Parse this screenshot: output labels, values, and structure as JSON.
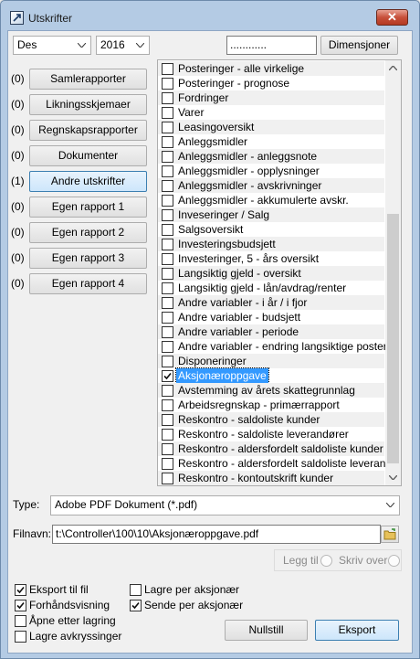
{
  "window": {
    "title": "Utskrifter",
    "close_label": "✕"
  },
  "filters": {
    "month": "Des",
    "year": "2016",
    "search_value": "............",
    "dimensions_label": "Dimensjoner"
  },
  "reports": [
    {
      "count": "(0)",
      "label": "Samlerapporter",
      "active": false
    },
    {
      "count": "(0)",
      "label": "Likningsskjemaer",
      "active": false
    },
    {
      "count": "(0)",
      "label": "Regnskapsrapporter",
      "active": false
    },
    {
      "count": "(0)",
      "label": "Dokumenter",
      "active": false
    },
    {
      "count": "(1)",
      "label": "Andre utskrifter",
      "active": true
    },
    {
      "count": "(0)",
      "label": "Egen rapport 1",
      "active": false
    },
    {
      "count": "(0)",
      "label": "Egen rapport 2",
      "active": false
    },
    {
      "count": "(0)",
      "label": "Egen rapport 3",
      "active": false
    },
    {
      "count": "(0)",
      "label": "Egen rapport 4",
      "active": false
    }
  ],
  "report_list": [
    {
      "label": "Posteringer - alle virkelige",
      "checked": false
    },
    {
      "label": "Posteringer - prognose",
      "checked": false
    },
    {
      "label": "Fordringer",
      "checked": false
    },
    {
      "label": "Varer",
      "checked": false
    },
    {
      "label": "Leasingoversikt",
      "checked": false
    },
    {
      "label": "Anleggsmidler",
      "checked": false
    },
    {
      "label": "Anleggsmidler - anleggsnote",
      "checked": false
    },
    {
      "label": "Anleggsmidler - opplysninger",
      "checked": false
    },
    {
      "label": "Anleggsmidler - avskrivninger",
      "checked": false
    },
    {
      "label": "Anleggsmidler - akkumulerte avskr.",
      "checked": false
    },
    {
      "label": "Inveseringer / Salg",
      "checked": false
    },
    {
      "label": "Salgsoversikt",
      "checked": false
    },
    {
      "label": "Investeringsbudsjett",
      "checked": false
    },
    {
      "label": "Investeringer, 5 - års oversikt",
      "checked": false
    },
    {
      "label": "Langsiktig gjeld - oversikt",
      "checked": false
    },
    {
      "label": "Langsiktig gjeld - lån/avdrag/renter",
      "checked": false
    },
    {
      "label": "Andre variabler - i år / i fjor",
      "checked": false
    },
    {
      "label": "Andre variabler - budsjett",
      "checked": false
    },
    {
      "label": "Andre variabler - periode",
      "checked": false
    },
    {
      "label": "Andre variabler - endring langsiktige poster",
      "checked": false
    },
    {
      "label": "Disponeringer",
      "checked": false
    },
    {
      "label": "Aksjonæroppgave",
      "checked": true,
      "selected": true
    },
    {
      "label": "Avstemming av årets skattegrunnlag",
      "checked": false
    },
    {
      "label": "Arbeidsregnskap - primærrapport",
      "checked": false
    },
    {
      "label": "Reskontro - saldoliste kunder",
      "checked": false
    },
    {
      "label": "Reskontro - saldoliste leverandører",
      "checked": false
    },
    {
      "label": "Reskontro - aldersfordelt saldoliste kunder",
      "checked": false
    },
    {
      "label": "Reskontro - aldersfordelt saldoliste leverandører",
      "checked": false
    },
    {
      "label": "Reskontro - kontoutskrift kunder",
      "checked": false
    }
  ],
  "output": {
    "type_label": "Type:",
    "type_value": "Adobe PDF Dokument (*.pdf)",
    "filename_label": "Filnavn:",
    "filename_value": "t:\\Controller\\100\\10\\Aksjonæroppgave.pdf",
    "add_label": "Legg til",
    "overwrite_label": "Skriv over"
  },
  "options": {
    "export_to_file": {
      "label": "Eksport til fil",
      "checked": true
    },
    "preview": {
      "label": "Forhåndsvisning",
      "checked": true
    },
    "open_after_save": {
      "label": "Åpne etter lagring",
      "checked": false
    },
    "save_checks": {
      "label": "Lagre avkryssinger",
      "checked": false
    },
    "save_per_shareholder": {
      "label": "Lagre per aksjonær",
      "checked": false
    },
    "send_per_shareholder": {
      "label": "Sende per aksjonær",
      "checked": true
    }
  },
  "actions": {
    "reset_label": "Nullstill",
    "export_label": "Eksport"
  }
}
